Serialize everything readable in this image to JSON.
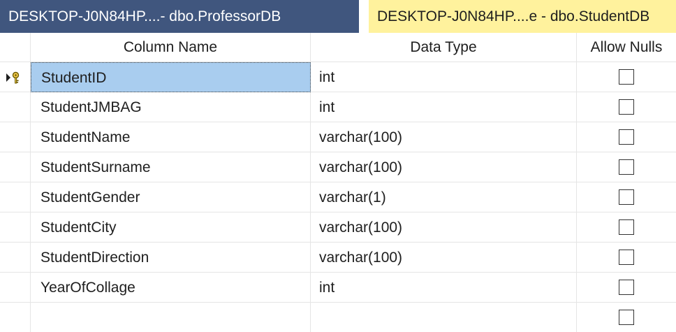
{
  "tabs": [
    {
      "label": "DESKTOP-J0N84HP....- dbo.ProfessorDB",
      "active": false
    },
    {
      "label": "DESKTOP-J0N84HP....e - dbo.StudentDB",
      "active": true
    }
  ],
  "grid": {
    "headers": {
      "column_name": "Column Name",
      "data_type": "Data Type",
      "allow_nulls": "Allow Nulls"
    },
    "rows": [
      {
        "name": "StudentID",
        "type": "int",
        "allow_nulls": false,
        "primary_key": true,
        "selected": true
      },
      {
        "name": "StudentJMBAG",
        "type": "int",
        "allow_nulls": false
      },
      {
        "name": "StudentName",
        "type": "varchar(100)",
        "allow_nulls": false
      },
      {
        "name": "StudentSurname",
        "type": "varchar(100)",
        "allow_nulls": false
      },
      {
        "name": "StudentGender",
        "type": "varchar(1)",
        "allow_nulls": false
      },
      {
        "name": "StudentCity",
        "type": "varchar(100)",
        "allow_nulls": false
      },
      {
        "name": "StudentDirection",
        "type": "varchar(100)",
        "allow_nulls": false
      },
      {
        "name": "YearOfCollage",
        "type": "int",
        "allow_nulls": false
      },
      {
        "name": "",
        "type": "",
        "allow_nulls": false
      }
    ]
  },
  "icons": {
    "row_indicator": "current-row-arrow-icon",
    "primary_key": "primary-key-icon"
  },
  "colors": {
    "inactive_tab": "#40567e",
    "active_tab": "#fff29d",
    "selected_cell": "#a9cdef",
    "grid_line": "#e5e5e5"
  }
}
